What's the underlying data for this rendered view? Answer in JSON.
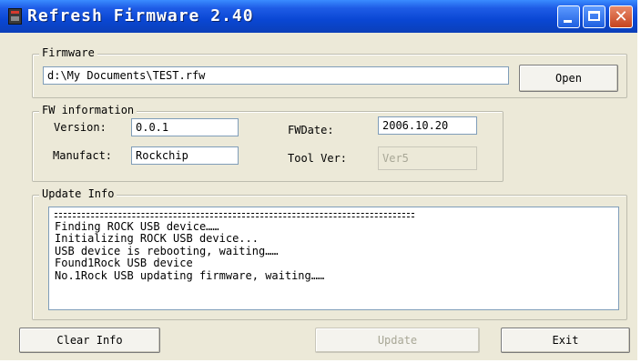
{
  "window": {
    "title": "Refresh Firmware 2.40"
  },
  "firmware": {
    "legend": "Firmware",
    "path": "d:\\My Documents\\TEST.rfw",
    "open_label": "Open"
  },
  "fw_info": {
    "legend": "FW information",
    "version_label": "Version:",
    "version_value": "0.0.1",
    "fwdate_label": "FWDate:",
    "fwdate_value": "2006.10.20",
    "manufacturer_label": "Manufact:",
    "manufacturer_value": "Rockchip",
    "toolver_label": "Tool Ver:",
    "toolver_value": "Ver5"
  },
  "update_info": {
    "legend": "Update Info",
    "lines": [
      "Finding ROCK USB device……",
      "Initializing ROCK USB device...",
      "USB device is rebooting, waiting……",
      "Found1Rock USB device",
      "No.1Rock USB updating firmware, waiting……"
    ]
  },
  "buttons": {
    "clear_label": "Clear Info",
    "update_label": "Update",
    "exit_label": "Exit"
  },
  "colors": {
    "titlebar": "#0A47D4",
    "dialog_bg": "#ECE9D8",
    "close_button": "#C6431E"
  }
}
